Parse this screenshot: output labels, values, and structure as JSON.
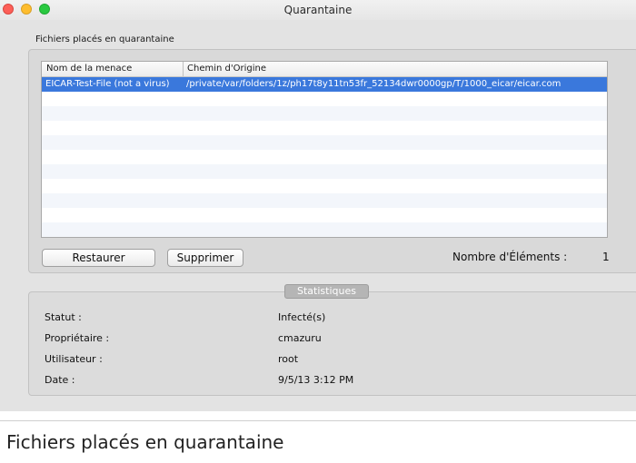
{
  "window": {
    "title": "Quarantaine"
  },
  "group_label": "Fichiers placés en quarantaine",
  "table": {
    "columns": [
      "Nom de la menace",
      "Chemin d'Origine"
    ],
    "rows": [
      {
        "threat": "EICAR-Test-File (not a virus)",
        "path": "/private/var/folders/1z/ph17t8y11tn53fr_52134dwr0000gp/T/1000_eicar/eicar.com",
        "selected": true
      }
    ]
  },
  "buttons": {
    "restore": "Restaurer",
    "delete": "Supprimer"
  },
  "count": {
    "label": "Nombre d'Éléments :",
    "value": "1"
  },
  "stats": {
    "title": "Statistiques",
    "items": [
      {
        "label": "Statut :",
        "value": "Infecté(s)"
      },
      {
        "label": "Propriétaire :",
        "value": "cmazuru"
      },
      {
        "label": "Utilisateur :",
        "value": "root"
      },
      {
        "label": "Date :",
        "value": "9/5/13 3:12 PM"
      }
    ]
  },
  "caption": "Fichiers placés en quarantaine",
  "colors": {
    "selection": "#3a78dc",
    "close": "#fd5f58",
    "minimize": "#febd2e",
    "maximize": "#29c940"
  }
}
